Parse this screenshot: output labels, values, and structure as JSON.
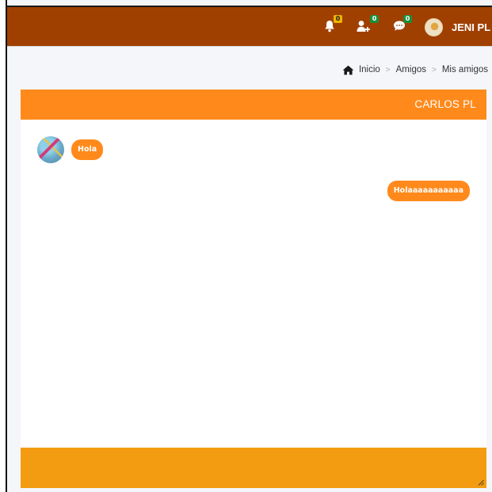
{
  "navbar": {
    "notifications": {
      "icon": "bell-icon",
      "count": "0"
    },
    "friend_requests": {
      "icon": "user-plus-icon",
      "count": "0"
    },
    "messages": {
      "icon": "comment-icon",
      "count": "0"
    },
    "user": {
      "name": "JENI PL",
      "avatar": "user-avatar"
    }
  },
  "breadcrumb": {
    "home_icon": "home-icon",
    "items": [
      "Inicio",
      "Amigos",
      "Mis amigos"
    ],
    "separator": ">"
  },
  "chat": {
    "title": "CARLOS PL",
    "messages": [
      {
        "direction": "in",
        "text": "Hola"
      },
      {
        "direction": "out",
        "text": "Holaaaaaaaaaaa"
      }
    ]
  },
  "colors": {
    "navbar": "#a04000",
    "header": "#ff8a1b",
    "bubble": "#ff8a1b",
    "footer": "#f39c12"
  }
}
